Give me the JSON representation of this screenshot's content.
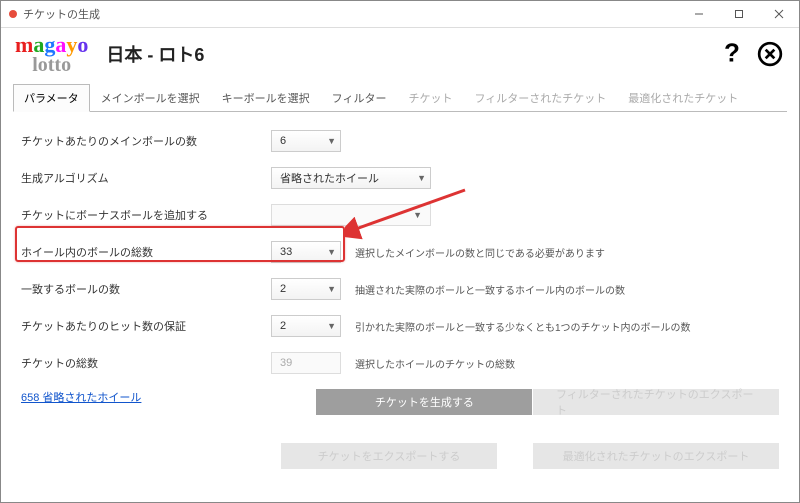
{
  "titlebar": {
    "title": "チケットの生成"
  },
  "header": {
    "app_title": "日本 - ロト6"
  },
  "tabs": [
    {
      "label": "パラメータ",
      "state": "active"
    },
    {
      "label": "メインボールを選択",
      "state": ""
    },
    {
      "label": "キーボールを選択",
      "state": ""
    },
    {
      "label": "フィルター",
      "state": ""
    },
    {
      "label": "チケット",
      "state": "disabled"
    },
    {
      "label": "フィルターされたチケット",
      "state": "disabled"
    },
    {
      "label": "最適化されたチケット",
      "state": "disabled"
    }
  ],
  "fields": {
    "main_per_ticket": {
      "label": "チケットあたりのメインボールの数",
      "value": "6"
    },
    "algorithm": {
      "label": "生成アルゴリズム",
      "value": "省略されたホイール"
    },
    "add_bonus": {
      "label": "チケットにボーナスボールを追加する",
      "value": ""
    },
    "total_in_wheel": {
      "label": "ホイール内のボールの総数",
      "value": "33",
      "hint": "選択したメインボールの数と同じである必要があります"
    },
    "match_count": {
      "label": "一致するボールの数",
      "value": "2",
      "hint": "抽選された実際のボールと一致するホイール内のボールの数"
    },
    "hit_guarantee": {
      "label": "チケットあたりのヒット数の保証",
      "value": "2",
      "hint": "引かれた実際のボールと一致する少なくとも1つのチケット内のボールの数"
    },
    "ticket_total": {
      "label": "チケットの総数",
      "value": "39",
      "hint": "選択したホイールのチケットの総数"
    }
  },
  "link": {
    "label": "658 省略されたホイール"
  },
  "buttons": {
    "generate": "チケットを生成する",
    "export_filtered": "フィルターされたチケットのエクスポート",
    "export_tickets": "チケットをエクスポートする",
    "export_optim": "最適化されたチケットのエクスポート"
  }
}
